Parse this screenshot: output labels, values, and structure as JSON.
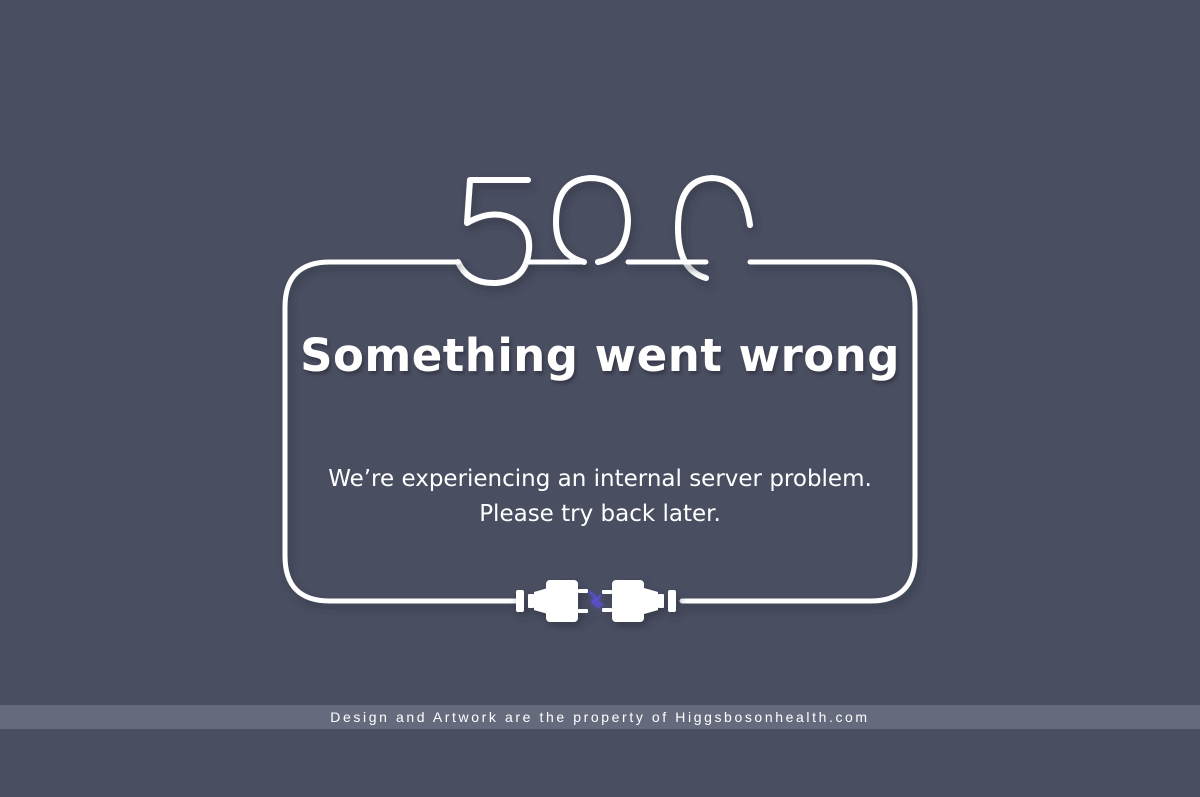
{
  "error": {
    "code": "500",
    "headline": "Something went wrong",
    "message_line1": "We’re experiencing an internal server problem.",
    "message_line2": "Please try back later."
  },
  "footer": {
    "credit": "Design and Artwork are the property of Higgsbosonhealth.com"
  },
  "colors": {
    "background": "#4a4e61",
    "footer_bar": "#656a7d",
    "neon": "#ffffff",
    "spark": "#5a4fd0"
  },
  "icons": {
    "plug": "unplugged-cable-icon"
  }
}
